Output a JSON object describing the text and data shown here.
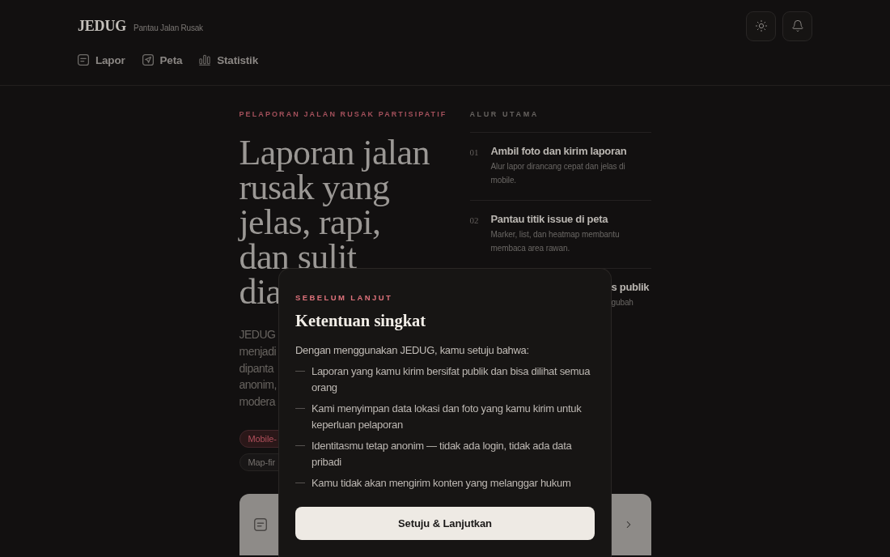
{
  "header": {
    "logo": "JEDUG",
    "tagline": "Pantau Jalan Rusak",
    "nav": [
      {
        "kind": "report",
        "label": "Lapor",
        "selected": false
      },
      {
        "kind": "map",
        "label": "Peta",
        "selected": false
      },
      {
        "kind": "stats",
        "label": "Statistik",
        "selected": false
      }
    ],
    "actions": [
      {
        "kind": "theme"
      },
      {
        "kind": "notifications"
      }
    ]
  },
  "hero": {
    "eyebrow": "PELAPORAN JALAN RUSAK PARTISIPATIF",
    "title_lines": [
      "Laporan jalan",
      "rusak yang",
      "jelas, rapi,",
      "dan sulit",
      "dia"
    ],
    "intro_lines": [
      "JEDUG",
      "menjadi",
      "dipanta",
      "anonim,",
      "modera"
    ],
    "tags": [
      {
        "kind": "accent",
        "label": "Mobile-"
      },
      {
        "kind": "neutral",
        "label": "Map-fir"
      }
    ]
  },
  "flow": {
    "label": "ALUR UTAMA",
    "steps": [
      {
        "number": "01",
        "title": "Ambil foto dan kirim laporan",
        "description": "Alur lapor dirancang cepat dan jelas di mobile."
      },
      {
        "number": "02",
        "title": "Pantau titik issue di peta",
        "description": "Marker, list, dan heatmap membantu membaca area rawan."
      },
      {
        "title": "s publik",
        "description": "gubah"
      }
    ]
  },
  "dialog": {
    "eyebrow": "SEBELUM LANJUT",
    "title": "Ketentuan singkat",
    "intro": "Dengan menggunakan JEDUG, kamu setuju bahwa:",
    "terms": [
      {
        "marker": "—",
        "text": "Laporan yang kamu kirim bersifat publik dan bisa dilihat semua orang"
      },
      {
        "marker": "—",
        "text": "Kami menyimpan data lokasi dan foto yang kamu kirim untuk keperluan pelaporan"
      },
      {
        "marker": "—",
        "text": "Identitasmu tetap anonim — tidak ada login, tidak ada data pribadi"
      },
      {
        "marker": "—",
        "text": "Kamu tidak akan mengirim konten yang melanggar hukum"
      }
    ],
    "confirm_button": "Setuju & Lanjutkan"
  }
}
